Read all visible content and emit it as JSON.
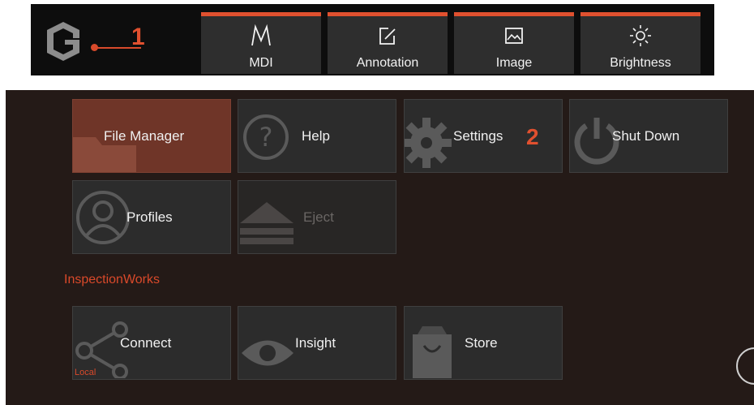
{
  "toolbar": {
    "callout_1": "1",
    "buttons": [
      {
        "label": "MDI",
        "icon": "mdi-icon"
      },
      {
        "label": "Annotation",
        "icon": "annotation-icon"
      },
      {
        "label": "Image",
        "icon": "image-icon"
      },
      {
        "label": "Brightness",
        "icon": "brightness-icon"
      }
    ],
    "accent_color": "#e0512f"
  },
  "menu": {
    "callout_2": "2",
    "tiles": [
      {
        "label": "File Manager",
        "icon": "folder-icon",
        "state": "selected"
      },
      {
        "label": "Help",
        "icon": "help-icon"
      },
      {
        "label": "Settings",
        "icon": "gear-icon"
      },
      {
        "label": "Shut Down",
        "icon": "power-icon"
      },
      {
        "label": "Profiles",
        "icon": "user-icon"
      },
      {
        "label": "Eject",
        "icon": "eject-icon",
        "state": "disabled"
      }
    ],
    "section_title": "InspectionWorks",
    "inspectionworks_tiles": [
      {
        "label": "Connect",
        "icon": "share-icon",
        "tag": "Local"
      },
      {
        "label": "Insight",
        "icon": "eye-icon"
      },
      {
        "label": "Store",
        "icon": "store-bag-icon"
      }
    ],
    "accent_color": "#d9492a",
    "selected_color": "#6f3528"
  }
}
